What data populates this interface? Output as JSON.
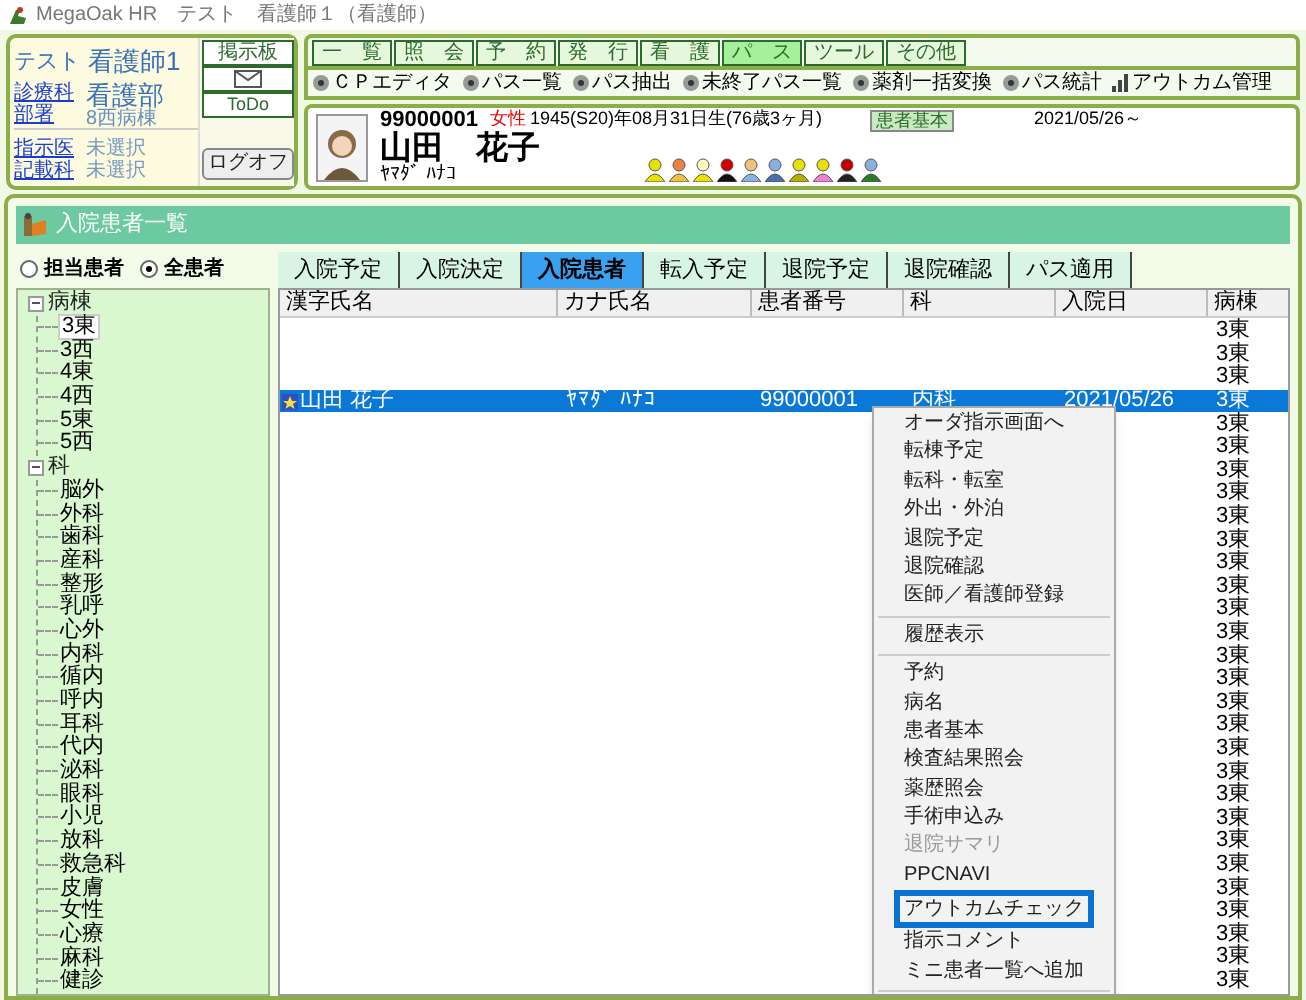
{
  "window": {
    "title": "MegaOak HR　テスト　看護師１（看護師）"
  },
  "user_panel": {
    "user": "テスト",
    "role": "看護師1",
    "links_1": [
      "診療科",
      "部署"
    ],
    "department": "看護部",
    "ward": "8西病棟",
    "links_2": [
      "指示医",
      "記載科"
    ],
    "unselected": [
      "未選択",
      "未選択"
    ],
    "board_button": "掲示板",
    "todo_button": "ToDo",
    "logoff_button": "ログオフ"
  },
  "menu_tabs": [
    {
      "label": "一　覧",
      "selected": false
    },
    {
      "label": "照　会",
      "selected": false
    },
    {
      "label": "予　約",
      "selected": false
    },
    {
      "label": "発　行",
      "selected": false
    },
    {
      "label": "看　護",
      "selected": false
    },
    {
      "label": "パ　ス",
      "selected": true
    },
    {
      "label": "ツール",
      "selected": false
    },
    {
      "label": "その他",
      "selected": false
    }
  ],
  "toolbar": [
    {
      "label": "ＣＰエディタ",
      "kind": "disc"
    },
    {
      "label": "パス一覧",
      "kind": "disc"
    },
    {
      "label": "パス抽出",
      "kind": "disc"
    },
    {
      "label": "未終了パス一覧",
      "kind": "disc"
    },
    {
      "label": "薬剤一括変換",
      "kind": "disc"
    },
    {
      "label": "パス統計",
      "kind": "disc"
    },
    {
      "label": "アウトカム管理",
      "kind": "chart"
    }
  ],
  "patient": {
    "id": "99000001",
    "sex": "女性",
    "birth": "1945(S20)年08月31日生(76歳3ヶ月)",
    "badge": "患者基本",
    "date": "2021/05/26～",
    "name": "山田　花子",
    "kana": "ﾔﾏﾀﾞ ﾊﾅｺ"
  },
  "panel": {
    "title": "入院患者一覧"
  },
  "scope": [
    {
      "label": "担当患者",
      "selected": false
    },
    {
      "label": "全患者",
      "selected": true
    }
  ],
  "tabs": [
    {
      "label": "入院予定",
      "selected": false
    },
    {
      "label": "入院決定",
      "selected": false
    },
    {
      "label": "入院患者",
      "selected": true
    },
    {
      "label": "転入予定",
      "selected": false
    },
    {
      "label": "退院予定",
      "selected": false
    },
    {
      "label": "退院確認",
      "selected": false
    },
    {
      "label": "パス適用",
      "selected": false
    }
  ],
  "tree": [
    {
      "label": "病棟",
      "expanded": true,
      "children": [
        {
          "label": "3東",
          "selected": true
        },
        {
          "label": "3西",
          "selected": false
        },
        {
          "label": "4東",
          "selected": false
        },
        {
          "label": "4西",
          "selected": false
        },
        {
          "label": "5東",
          "selected": false
        },
        {
          "label": "5西",
          "selected": false
        }
      ]
    },
    {
      "label": "科",
      "expanded": true,
      "children": [
        {
          "label": "脳外",
          "selected": false
        },
        {
          "label": "外科",
          "selected": false
        },
        {
          "label": "歯科",
          "selected": false
        },
        {
          "label": "産科",
          "selected": false
        },
        {
          "label": "整形",
          "selected": false
        },
        {
          "label": "乳呼",
          "selected": false
        },
        {
          "label": "心外",
          "selected": false
        },
        {
          "label": "内科",
          "selected": false
        },
        {
          "label": "循内",
          "selected": false
        },
        {
          "label": "呼内",
          "selected": false
        },
        {
          "label": "耳科",
          "selected": false
        },
        {
          "label": "代内",
          "selected": false
        },
        {
          "label": "泌科",
          "selected": false
        },
        {
          "label": "眼科",
          "selected": false
        },
        {
          "label": "小児",
          "selected": false
        },
        {
          "label": "放科",
          "selected": false
        },
        {
          "label": "救急科",
          "selected": false
        },
        {
          "label": "皮膚",
          "selected": false
        },
        {
          "label": "女性",
          "selected": false
        },
        {
          "label": "心療",
          "selected": false
        },
        {
          "label": "麻科",
          "selected": false
        },
        {
          "label": "健診",
          "selected": false
        }
      ]
    }
  ],
  "table": {
    "columns": [
      "漢字氏名",
      "カナ氏名",
      "患者番号",
      "科",
      "入院日",
      "病棟"
    ],
    "rows": [
      {
        "cells": [
          "",
          "",
          "",
          "",
          "",
          "3東"
        ],
        "selected": false
      },
      {
        "cells": [
          "",
          "",
          "",
          "",
          "",
          "3東"
        ],
        "selected": false
      },
      {
        "cells": [
          "",
          "",
          "",
          "",
          "",
          "3東"
        ],
        "selected": false
      },
      {
        "cells": [
          "山田 花子",
          "ﾔﾏﾀﾞ ﾊﾅｺ",
          "99000001",
          "内科",
          "2021/05/26",
          "3東"
        ],
        "selected": true,
        "starred": true
      },
      {
        "cells": [
          "",
          "",
          "",
          "",
          "",
          "3東"
        ],
        "selected": false
      },
      {
        "cells": [
          "",
          "",
          "",
          "",
          "",
          "3東"
        ],
        "selected": false
      },
      {
        "cells": [
          "",
          "",
          "",
          "",
          "",
          "3東"
        ],
        "selected": false
      },
      {
        "cells": [
          "",
          "",
          "",
          "",
          "",
          "3東"
        ],
        "selected": false
      },
      {
        "cells": [
          "",
          "",
          "",
          "",
          "",
          "3東"
        ],
        "selected": false
      },
      {
        "cells": [
          "",
          "",
          "",
          "",
          "",
          "3東"
        ],
        "selected": false
      },
      {
        "cells": [
          "",
          "",
          "",
          "",
          "",
          "3東"
        ],
        "selected": false
      },
      {
        "cells": [
          "",
          "",
          "",
          "",
          "",
          "3東"
        ],
        "selected": false
      },
      {
        "cells": [
          "",
          "",
          "",
          "",
          "",
          "3東"
        ],
        "selected": false
      },
      {
        "cells": [
          "",
          "",
          "",
          "",
          "",
          "3東"
        ],
        "selected": false
      },
      {
        "cells": [
          "",
          "",
          "",
          "",
          "",
          "3東"
        ],
        "selected": false
      },
      {
        "cells": [
          "",
          "",
          "",
          "",
          "",
          "3東"
        ],
        "selected": false
      },
      {
        "cells": [
          "",
          "",
          "",
          "",
          "",
          "3東"
        ],
        "selected": false
      },
      {
        "cells": [
          "",
          "",
          "",
          "",
          "",
          "3東"
        ],
        "selected": false
      },
      {
        "cells": [
          "",
          "",
          "",
          "",
          "",
          "3東"
        ],
        "selected": false
      },
      {
        "cells": [
          "",
          "",
          "",
          "",
          "",
          "3東"
        ],
        "selected": false
      },
      {
        "cells": [
          "",
          "",
          "",
          "",
          "",
          "3東"
        ],
        "selected": false
      },
      {
        "cells": [
          "",
          "",
          "",
          "",
          "",
          "3東"
        ],
        "selected": false
      },
      {
        "cells": [
          "",
          "",
          "",
          "",
          "",
          "3東"
        ],
        "selected": false
      },
      {
        "cells": [
          "",
          "",
          "",
          "",
          "",
          "3東"
        ],
        "selected": false
      },
      {
        "cells": [
          "",
          "",
          "",
          "",
          "",
          "3東"
        ],
        "selected": false
      },
      {
        "cells": [
          "",
          "",
          "",
          "",
          "",
          "3東"
        ],
        "selected": false
      },
      {
        "cells": [
          "",
          "",
          "",
          "",
          "",
          "3東"
        ],
        "selected": false
      },
      {
        "cells": [
          "",
          "",
          "",
          "",
          "",
          "3東"
        ],
        "selected": false
      },
      {
        "cells": [
          "",
          "",
          "",
          "",
          "",
          "3東"
        ],
        "selected": false
      }
    ]
  },
  "context_menu": [
    {
      "kind": "item",
      "label": "オーダ指示画面へ",
      "disabled": false,
      "highlighted": false
    },
    {
      "kind": "item",
      "label": "転棟予定",
      "disabled": false,
      "highlighted": false
    },
    {
      "kind": "item",
      "label": "転科・転室",
      "disabled": false,
      "highlighted": false
    },
    {
      "kind": "item",
      "label": "外出・外泊",
      "disabled": false,
      "highlighted": false
    },
    {
      "kind": "item",
      "label": "退院予定",
      "disabled": false,
      "highlighted": false
    },
    {
      "kind": "item",
      "label": "退院確認",
      "disabled": false,
      "highlighted": false
    },
    {
      "kind": "item",
      "label": "医師／看護師登録",
      "disabled": false,
      "highlighted": false
    },
    {
      "kind": "separator"
    },
    {
      "kind": "item",
      "label": "履歴表示",
      "disabled": false,
      "highlighted": false
    },
    {
      "kind": "separator"
    },
    {
      "kind": "item",
      "label": "予約",
      "disabled": false,
      "highlighted": false
    },
    {
      "kind": "item",
      "label": "病名",
      "disabled": false,
      "highlighted": false
    },
    {
      "kind": "item",
      "label": "患者基本",
      "disabled": false,
      "highlighted": false
    },
    {
      "kind": "item",
      "label": "検査結果照会",
      "disabled": false,
      "highlighted": false
    },
    {
      "kind": "item",
      "label": "薬歴照会",
      "disabled": false,
      "highlighted": false
    },
    {
      "kind": "item",
      "label": "手術申込み",
      "disabled": false,
      "highlighted": false
    },
    {
      "kind": "item",
      "label": "退院サマリ",
      "disabled": true,
      "highlighted": false
    },
    {
      "kind": "item",
      "label": "PPCNAVI",
      "disabled": false,
      "highlighted": false
    },
    {
      "kind": "item",
      "label": "アウトカムチェック",
      "disabled": false,
      "highlighted": true
    },
    {
      "kind": "item",
      "label": "指示コメント",
      "disabled": false,
      "highlighted": false
    },
    {
      "kind": "item",
      "label": "ミニ患者一覧へ追加",
      "disabled": false,
      "highlighted": false
    },
    {
      "kind": "separator"
    }
  ]
}
